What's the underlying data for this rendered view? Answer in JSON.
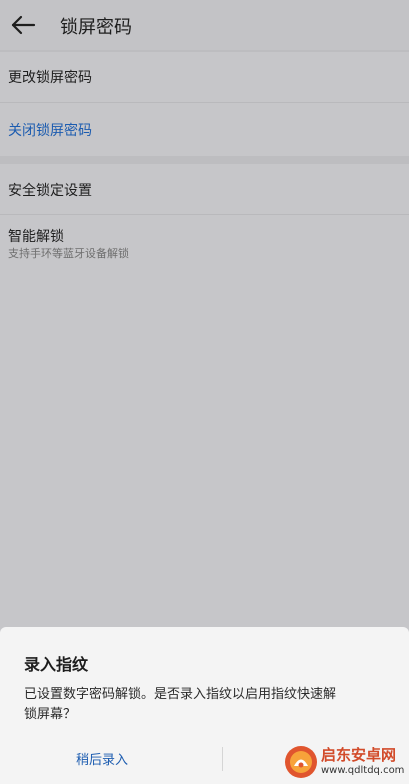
{
  "header": {
    "title": "锁屏密码",
    "back_icon": "arrow-left-icon"
  },
  "settings": {
    "change_password": "更改锁屏密码",
    "disable_password": "关闭锁屏密码",
    "secure_lock": "安全锁定设置",
    "smart_unlock": {
      "title": "智能解锁",
      "subtitle": "支持手环等蓝牙设备解锁"
    }
  },
  "dialog": {
    "title": "录入指纹",
    "message_line1": "已设置数字密码解锁。是否录入指纹以启用指纹快速解",
    "message_line2": "锁屏幕？",
    "later_button": "稍后录入"
  },
  "watermark": {
    "name": "启东安卓网",
    "url": "www.qdltdq.com"
  },
  "colors": {
    "accent": "#1c5cb0",
    "dialog_bg": "#f4f4f4",
    "overlay_bg": "#c6c6c9"
  }
}
